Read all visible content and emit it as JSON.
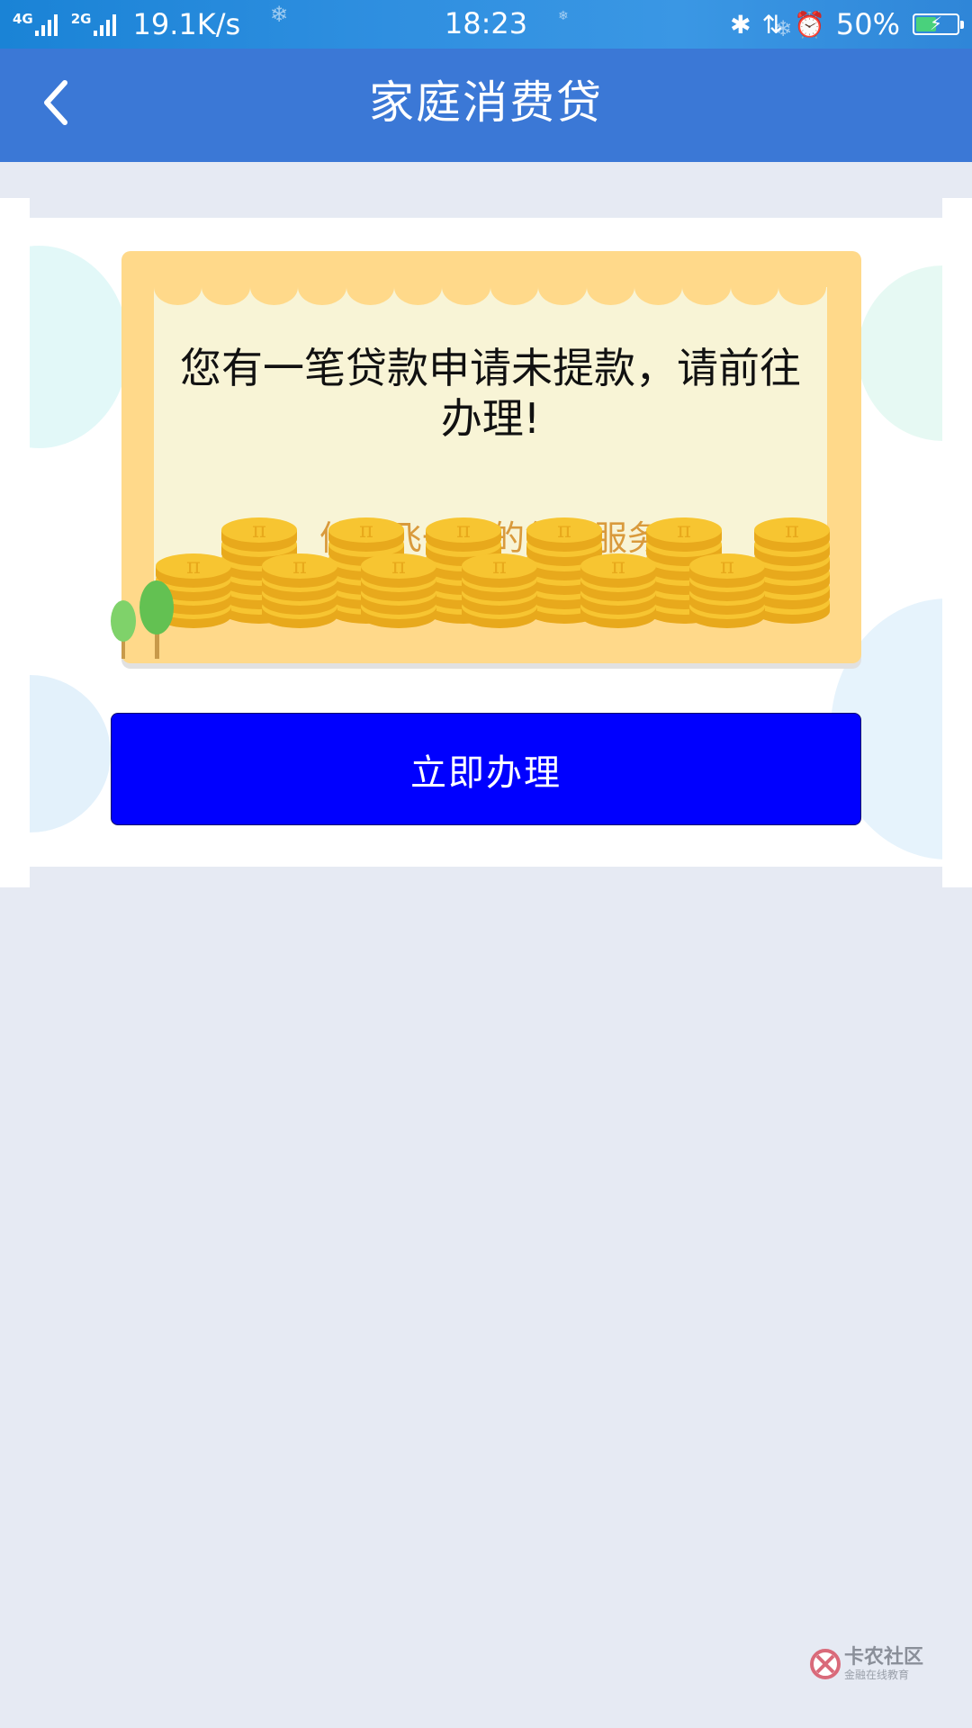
{
  "status_bar": {
    "network_type_1": "4G",
    "network_type_2": "4G",
    "network_type_3": "2G",
    "net_speed": "19.1K/s",
    "time": "18:23",
    "battery_percent": "50%",
    "battery_level": 0.5,
    "icons": [
      "bluetooth-icon",
      "data-arrows-icon",
      "alarm-icon",
      "battery-icon"
    ]
  },
  "app_bar": {
    "title": "家庭消费贷",
    "back_icon": "chevron-left-icon"
  },
  "card": {
    "message": "您有一笔贷款申请未提款，请前往办理!",
    "slogan": "体验飞一般的贷款服务",
    "coin_symbol": "π"
  },
  "actions": {
    "primary_label": "立即办理"
  },
  "watermark": {
    "title": "卡农社区",
    "subtitle": "金融在线教育"
  },
  "colors": {
    "status_bar": "#2f8fe0",
    "app_bar": "#3b78d6",
    "page_bg": "#e6eaf3",
    "card_outer": "#ffd98a",
    "card_inner": "#f8f4d6",
    "slogan": "#d99a3c",
    "button": "#0000ff",
    "coin": "#f7c531"
  }
}
